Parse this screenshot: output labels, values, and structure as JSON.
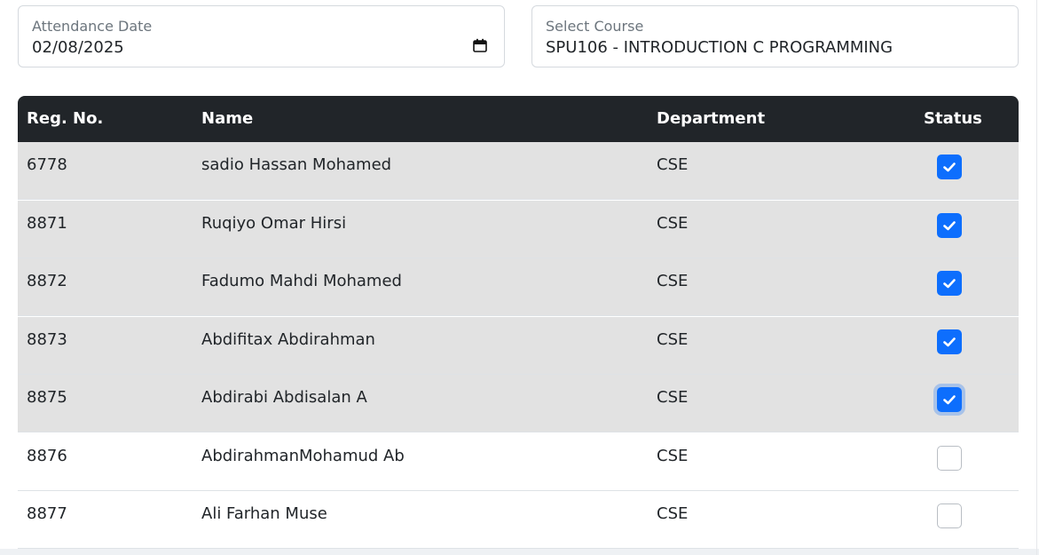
{
  "filters": {
    "date": {
      "label": "Attendance Date",
      "value": "02/08/2025",
      "icon": "calendar-icon"
    },
    "course": {
      "label": "Select Course",
      "value": "SPU106 - INTRODUCTION C PROGRAMMING"
    }
  },
  "table": {
    "columns": {
      "reg": "Reg. No.",
      "name": "Name",
      "department": "Department",
      "status": "Status"
    },
    "rows": [
      {
        "reg": "6778",
        "name": "sadio Hassan Mohamed",
        "department": "CSE",
        "checked": true
      },
      {
        "reg": "8871",
        "name": "Ruqiyo Omar Hirsi",
        "department": "CSE",
        "checked": true
      },
      {
        "reg": "8872",
        "name": "Fadumo Mahdi Mohamed",
        "department": "CSE",
        "checked": true
      },
      {
        "reg": "8873",
        "name": "Abdifitax Abdirahman",
        "department": "CSE",
        "checked": true
      },
      {
        "reg": "8875",
        "name": "Abdirabi Abdisalan A",
        "department": "CSE",
        "checked": true,
        "focused": true
      },
      {
        "reg": "8876",
        "name": "AbdirahmanMohamud Ab",
        "department": "CSE",
        "checked": false
      },
      {
        "reg": "8877",
        "name": "Ali Farhan Muse",
        "department": "CSE",
        "checked": false
      }
    ]
  },
  "colors": {
    "accent": "#0d6efd",
    "header_bg": "#212529",
    "selected_row_bg": "#e2e2e2"
  }
}
